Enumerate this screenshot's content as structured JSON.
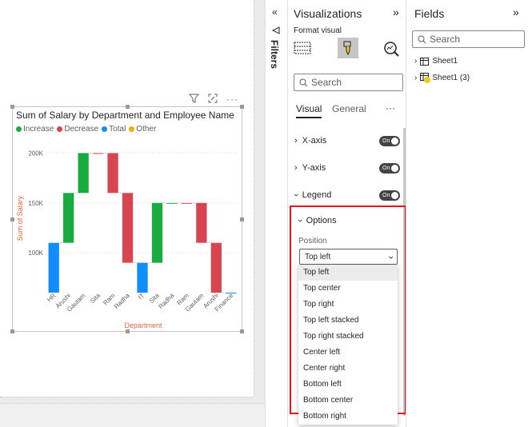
{
  "chart": {
    "title": "Sum of Salary by Department and Employee Name",
    "legend": [
      {
        "label": "Increase",
        "color": "#1aab40"
      },
      {
        "label": "Decrease",
        "color": "#d64550"
      },
      {
        "label": "Total",
        "color": "#118dff"
      },
      {
        "label": "Other",
        "color": "#e6b100"
      }
    ],
    "ylabel": "Sum of Salary",
    "xlabel": "Department"
  },
  "chart_data": {
    "type": "bar",
    "title": "Sum of Salary by Department and Employee Name",
    "xlabel": "Department",
    "ylabel": "Sum of Salary",
    "y_ticks": [
      "100K",
      "150K",
      "200K"
    ],
    "ylim": [
      60000,
      210000
    ],
    "categories": [
      "HR",
      "Arushi",
      "Gautam",
      "Sita",
      "Ram",
      "Radha",
      "IT",
      "Sita",
      "Radha",
      "Ram",
      "Gautam",
      "Arushi",
      "Finance"
    ],
    "bars": [
      {
        "category": "HR",
        "kind": "Total",
        "start": 60000,
        "end": 110000
      },
      {
        "category": "Arushi",
        "kind": "Increase",
        "start": 110000,
        "end": 160000
      },
      {
        "category": "Gautam",
        "kind": "Increase",
        "start": 160000,
        "end": 200000
      },
      {
        "category": "Sita",
        "kind": "Decrease",
        "start": 200000,
        "end": 200000
      },
      {
        "category": "Ram",
        "kind": "Decrease",
        "start": 200000,
        "end": 160000
      },
      {
        "category": "Radha",
        "kind": "Decrease",
        "start": 160000,
        "end": 90000
      },
      {
        "category": "IT",
        "kind": "Total",
        "start": 60000,
        "end": 90000
      },
      {
        "category": "Sita",
        "kind": "Increase",
        "start": 90000,
        "end": 150000
      },
      {
        "category": "Radha",
        "kind": "Increase",
        "start": 150000,
        "end": 150000
      },
      {
        "category": "Ram",
        "kind": "Decrease",
        "start": 150000,
        "end": 150000
      },
      {
        "category": "Gautam",
        "kind": "Decrease",
        "start": 150000,
        "end": 110000
      },
      {
        "category": "Arushi",
        "kind": "Decrease",
        "start": 110000,
        "end": 60000
      },
      {
        "category": "Finance",
        "kind": "Total",
        "start": 60000,
        "end": 60000
      }
    ]
  },
  "filters": {
    "label": "Filters"
  },
  "viz": {
    "title": "Visualizations",
    "format_visual": "Format visual",
    "search_placeholder": "Search",
    "tabs": [
      "Visual",
      "General"
    ],
    "more": "···",
    "sections": [
      {
        "label": "X-axis",
        "toggle": "On"
      },
      {
        "label": "Y-axis",
        "toggle": "On"
      },
      {
        "label": "Legend",
        "toggle": "On"
      }
    ],
    "options_label": "Options",
    "position_label": "Position",
    "position_value": "Top left",
    "position_options": [
      "Top left",
      "Top center",
      "Top right",
      "Top left stacked",
      "Top right stacked",
      "Center left",
      "Center right",
      "Bottom left",
      "Bottom center",
      "Bottom right"
    ]
  },
  "fields": {
    "title": "Fields",
    "search_placeholder": "Search",
    "tables": [
      "Sheet1",
      "Sheet1 (3)"
    ]
  }
}
